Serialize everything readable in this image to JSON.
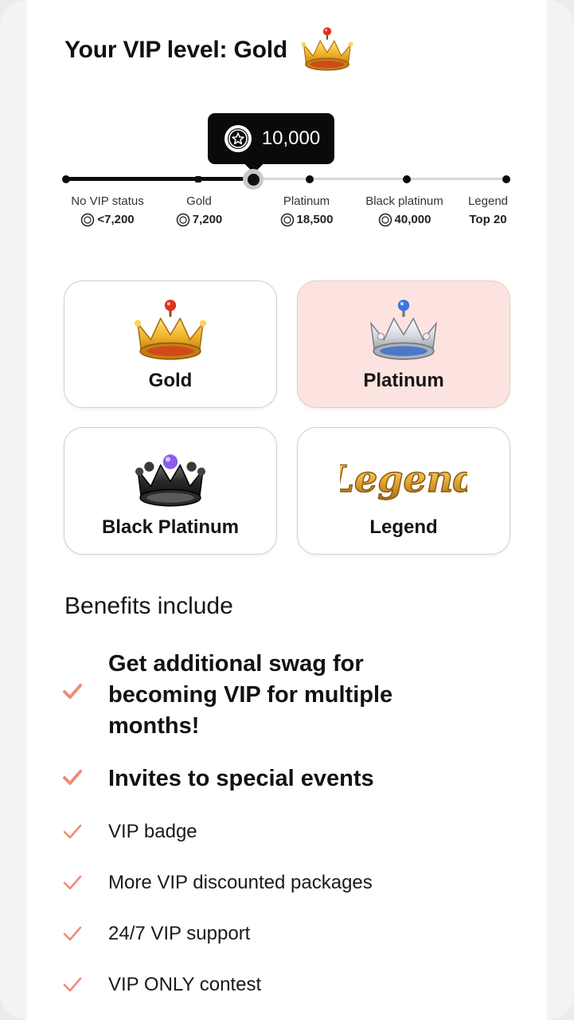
{
  "header": {
    "title": "Your VIP level: Gold",
    "crown_icon": "gold-crown-icon"
  },
  "progress": {
    "current_balance": "10,000",
    "tooltip_icon": "coin-star-icon",
    "levels": [
      {
        "name": "No VIP status",
        "value": "<7,200",
        "show_coin": true
      },
      {
        "name": "Gold",
        "value": "7,200",
        "show_coin": true
      },
      {
        "name": "Platinum",
        "value": "18,500",
        "show_coin": true
      },
      {
        "name": "Black platinum",
        "value": "40,000",
        "show_coin": true
      },
      {
        "name": "Legend",
        "value": "Top 20",
        "show_coin": false
      }
    ]
  },
  "tiers": [
    {
      "label": "Gold",
      "icon": "gold-crown-icon",
      "selected": false
    },
    {
      "label": "Platinum",
      "icon": "platinum-crown-icon",
      "selected": true
    },
    {
      "label": "Black Platinum",
      "icon": "black-platinum-crown-icon",
      "selected": false
    },
    {
      "label": "Legend",
      "icon": "legend-badge-icon",
      "selected": false,
      "badge_text": "Legend"
    }
  ],
  "benefits": {
    "title": "Benefits include",
    "items": [
      {
        "text": "Get additional swag for becoming VIP for multiple months!",
        "emphasis": "large"
      },
      {
        "text": "Invites to special events",
        "emphasis": "large"
      },
      {
        "text": "VIP badge",
        "emphasis": "normal"
      },
      {
        "text": "More VIP discounted packages",
        "emphasis": "normal"
      },
      {
        "text": "24/7 VIP support",
        "emphasis": "normal"
      },
      {
        "text": "VIP ONLY contest",
        "emphasis": "normal"
      }
    ]
  },
  "colors": {
    "accent_check": "#f08a78",
    "selected_tier_bg": "#fde3df",
    "track_fill": "#0c0c0c"
  }
}
